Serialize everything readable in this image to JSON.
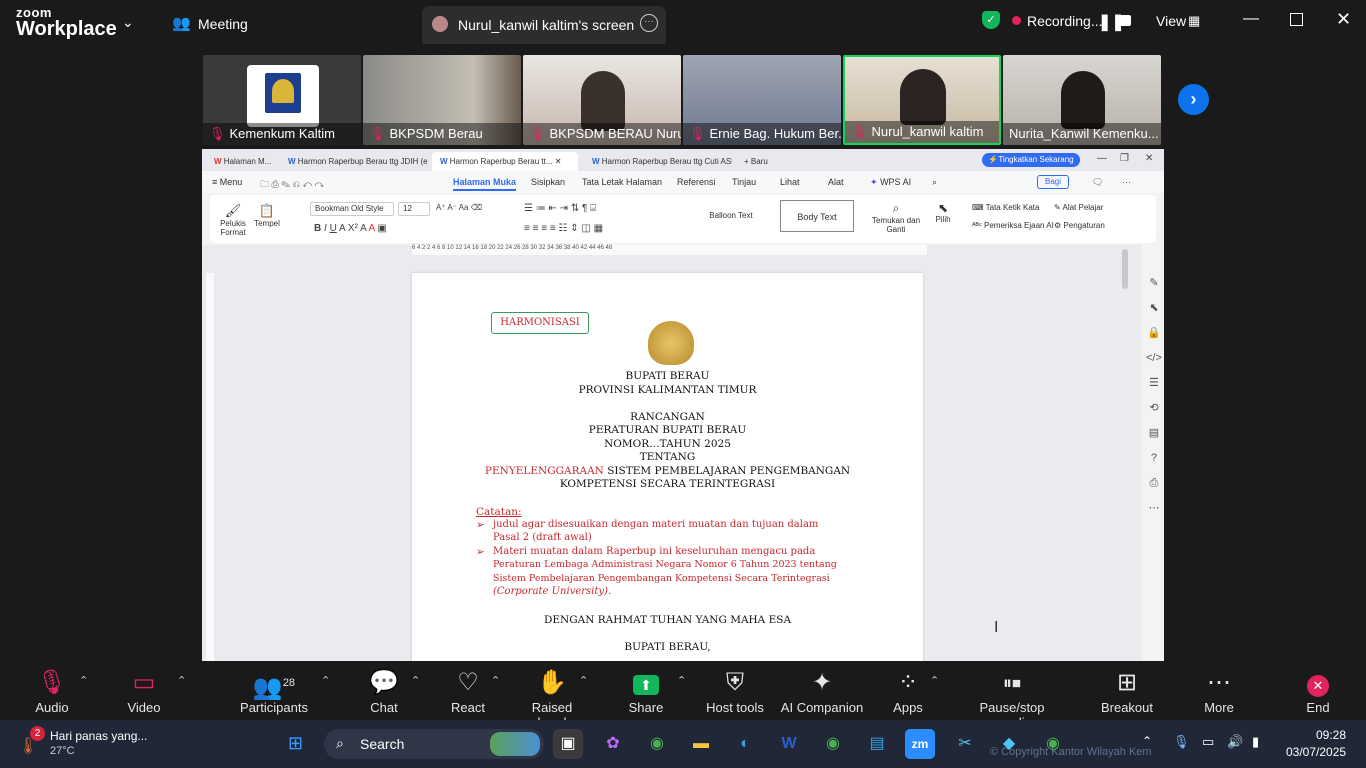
{
  "app": {
    "brand_top": "zoom",
    "brand_bottom": "Workplace"
  },
  "topbar": {
    "meeting_label": "Meeting",
    "share_tab": "Nurul_kanwil kaltim's screen",
    "recording": "Recording...",
    "view": "View"
  },
  "participants": [
    {
      "name": "Kemenkum Kaltim",
      "muted": true
    },
    {
      "name": "BKPSDM Berau",
      "muted": true
    },
    {
      "name": "BKPSDM BERAU Nuru...",
      "muted": true
    },
    {
      "name": "Ernie Bag. Hukum Ber...",
      "muted": true
    },
    {
      "name": "Nurul_kanwil kaltim",
      "muted": true
    },
    {
      "name": "Nurita_Kanwil Kemenku...",
      "muted": false
    }
  ],
  "wps": {
    "tabs": [
      "Halaman M...",
      "Harmon Raperbup Berau ttg JDIH (e...",
      "Harmon Raperbup Berau tt...",
      "Harmon Raperbup Berau ttg Cuti ASI...",
      "+ Baru"
    ],
    "upgrade": "Tingkatkan Sekarang",
    "menu": [
      "Menu",
      "Halaman Muka",
      "Sisipkan",
      "Tata Letak Halaman",
      "Referensi",
      "Tinjau",
      "Lihat",
      "Alat",
      "WPS AI"
    ],
    "share": "Bagi",
    "ribbon": {
      "painter": "Pelukis Format",
      "paste": "Tempel",
      "font": "Bookman Old Style",
      "size": "12",
      "style1": "Balloon Text",
      "style2": "Body Text",
      "find": "Temukan dan Ganti",
      "select": "Pilih",
      "tools": [
        "Tata Ketik Kata",
        "Alat Pelajar",
        "Pemeriksa Ejaan AI",
        "Pengaturan"
      ]
    },
    "ruler": "6 4 2 2 4 6 8 10 12 14 16 18 20 22 24 26 28 30 32 34 36 38 40 42 44 46 48"
  },
  "document": {
    "badge": "HARMONISASI",
    "l1": "BUPATI BERAU",
    "l2": "PROVINSI KALIMANTAN TIMUR",
    "l3": "RANCANGAN",
    "l4": "PERATURAN BUPATI BERAU",
    "l5": "NOMOR…TAHUN 2025",
    "l6": "TENTANG",
    "l7a": "PENYELENGGARAAN",
    "l7b": " SISTEM PEMBELAJARAN PENGEMBANGAN",
    "l8": "KOMPETENSI SECARA TERINTEGRASI",
    "note_title": "Catatan:",
    "n1a": "judul agar disesuaikan dengan materi muatan dan tujuan dalam",
    "n1b": "Pasal 2 (draft awal)",
    "n2a": "Materi muatan dalam Raperbup ini keseluruhan mengacu pada",
    "n2b": "Peraturan Lembaga Administrasi Negara Nomor 6 Tahun 2023 tentang",
    "n2c": "Sistem Pembelajaran Pengembangan Kompetensi Secara Terintegrasi",
    "n2d": "(Corporate University).",
    "l9": "DENGAN RAHMAT TUHAN YANG MAHA ESA",
    "l10": "BUPATI BERAU,"
  },
  "controls": [
    {
      "label": "Audio",
      "icon": "mic-off-icon"
    },
    {
      "label": "Video",
      "icon": "video-off-icon"
    },
    {
      "label": "Participants",
      "icon": "participants-icon",
      "count": "28"
    },
    {
      "label": "Chat",
      "icon": "chat-icon"
    },
    {
      "label": "React",
      "icon": "heart-icon"
    },
    {
      "label": "Raised hand",
      "icon": "hand-icon"
    },
    {
      "label": "Share",
      "icon": "share-icon"
    },
    {
      "label": "Host tools",
      "icon": "shield-icon"
    },
    {
      "label": "AI Companion",
      "icon": "sparkle-icon"
    },
    {
      "label": "Apps",
      "icon": "apps-icon"
    },
    {
      "label": "Pause/stop recording",
      "icon": "pause-stop-icon"
    },
    {
      "label": "Breakout rooms",
      "icon": "grid-icon"
    },
    {
      "label": "More",
      "icon": "more-icon"
    },
    {
      "label": "End",
      "icon": "end-icon"
    }
  ],
  "taskbar": {
    "weather_title": "Hari panas yang...",
    "weather_temp": "27°C",
    "weather_badge": "2",
    "search": "Search",
    "time": "09:28",
    "date": "03/07/2025",
    "watermark": "© Copyright Kantor Wilayah Kementerian Hukum Kalimantan Timur"
  },
  "colors": {
    "accent": "#0e72ed",
    "record": "#e0245e",
    "doc_red": "#c8282d",
    "share_green": "#12b65b"
  }
}
